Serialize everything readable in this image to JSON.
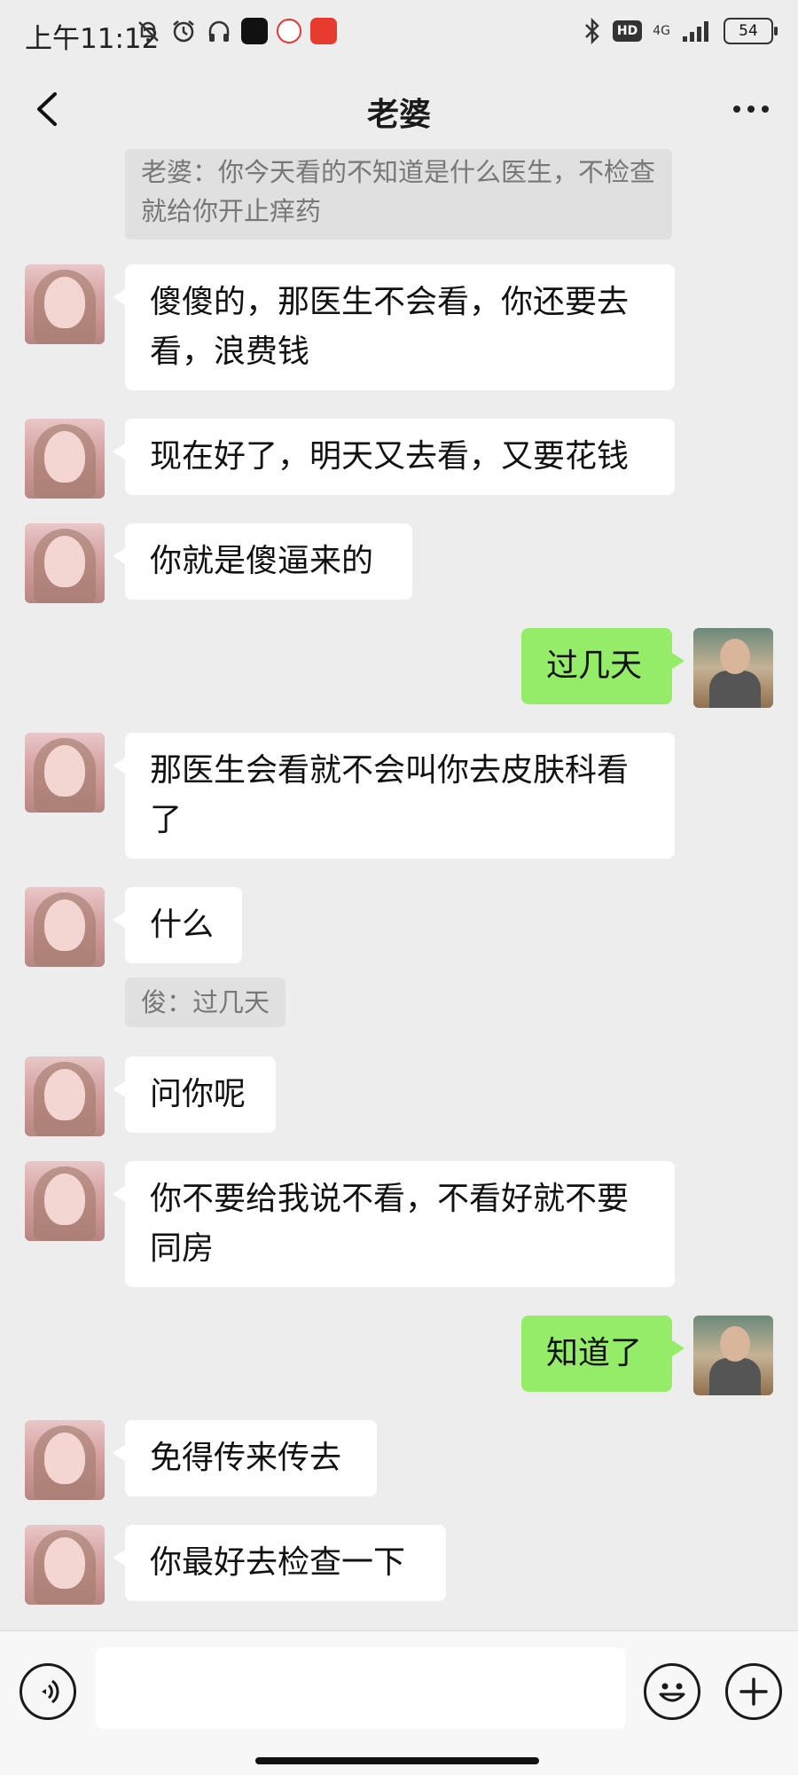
{
  "status_bar": {
    "time": "上午11:12",
    "network": "4G",
    "hd": "HD",
    "battery": "54"
  },
  "header": {
    "title": "老婆"
  },
  "messages": [
    {
      "type": "quote",
      "text": "老婆：你今天看的不知道是什么医生，不检查就给你开止痒药"
    },
    {
      "type": "in",
      "text": "傻傻的，那医生不会看，你还要去看，浪费钱"
    },
    {
      "type": "in",
      "text": "现在好了，明天又去看，又要花钱"
    },
    {
      "type": "in",
      "text": "你就是傻逼来的"
    },
    {
      "type": "out",
      "text": "过几天"
    },
    {
      "type": "in",
      "text": "那医生会看就不会叫你去皮肤科看了"
    },
    {
      "type": "in",
      "text": "什么"
    },
    {
      "type": "quote",
      "text": "俊：过几天"
    },
    {
      "type": "in",
      "text": "问你呢"
    },
    {
      "type": "in",
      "text": "你不要给我说不看，不看好就不要同房"
    },
    {
      "type": "out",
      "text": "知道了"
    },
    {
      "type": "in",
      "text": "免得传来传去"
    },
    {
      "type": "in",
      "text": "你最好去检查一下"
    }
  ],
  "input_bar": {
    "value": "",
    "icons": [
      "voice-icon",
      "emoji-icon",
      "plus-icon"
    ]
  },
  "colors": {
    "background": "#ededed",
    "incoming_bubble": "#ffffff",
    "outgoing_bubble": "#95ec69",
    "quote_bg": "#e0e0e0"
  }
}
